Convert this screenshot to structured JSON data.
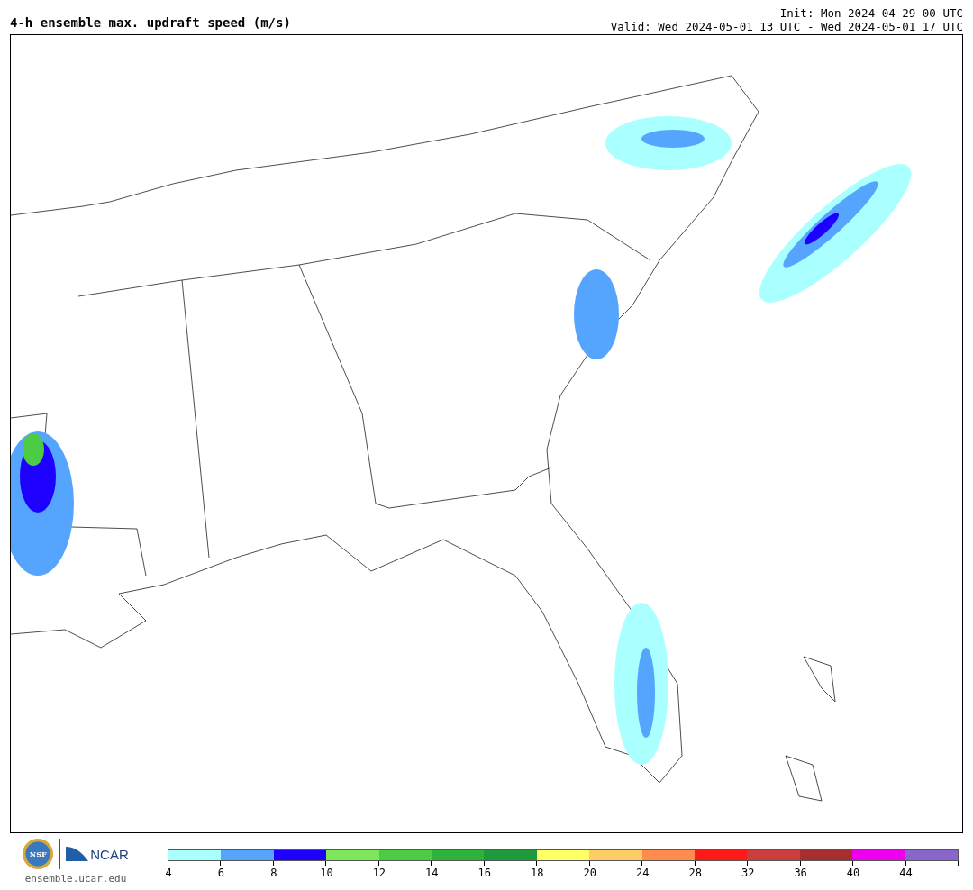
{
  "title": "4-h ensemble max. updraft speed (m/s)",
  "init": "Init: Mon 2024-04-29 00 UTC",
  "valid": "Valid: Wed 2024-05-01 13 UTC - Wed 2024-05-01 17 UTC",
  "logos": {
    "nsf": "NSF",
    "ncar": "NCAR",
    "website": "ensemble.ucar.edu"
  },
  "colorbar": [
    {
      "color": "#aaffff",
      "label": "4"
    },
    {
      "color": "#55a5ff",
      "label": "6"
    },
    {
      "color": "#1e00ff",
      "label": "8"
    },
    {
      "color": "#7ee65a",
      "label": "10"
    },
    {
      "color": "#4ccc44",
      "label": "12"
    },
    {
      "color": "#2db33a",
      "label": "14"
    },
    {
      "color": "#1e993c",
      "label": "16"
    },
    {
      "color": "#ffff66",
      "label": "18"
    },
    {
      "color": "#ffcc66",
      "label": "20"
    },
    {
      "color": "#ff8c4c",
      "label": "24"
    },
    {
      "color": "#ff1a1a",
      "label": "28"
    },
    {
      "color": "#cc3d3d",
      "label": "32"
    },
    {
      "color": "#a52e2e",
      "label": "36"
    },
    {
      "color": "#ee00ee",
      "label": "40"
    },
    {
      "color": "#8866cc",
      "label": "44"
    }
  ]
}
